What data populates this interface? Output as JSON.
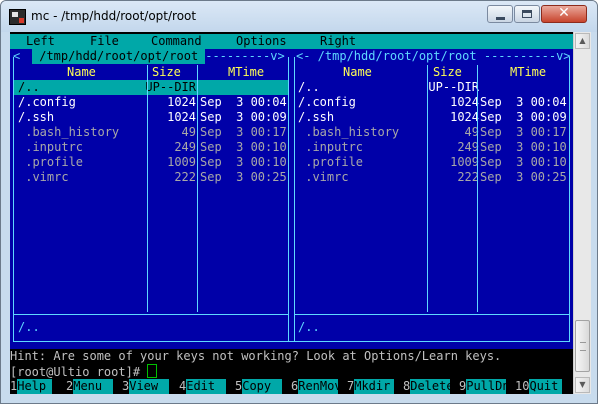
{
  "window": {
    "title": "mc - /tmp/hdd/root/opt/root"
  },
  "menu": [
    "Left",
    "File",
    "Command",
    "Options",
    "Right"
  ],
  "left_panel": {
    "path": " /tmp/hdd/root/opt/root ",
    "topbar_prefix": "<",
    "topbar_suffix": " ---------v>",
    "headers": {
      "name": "Name",
      "size": "Size",
      "mtime": "MTime"
    },
    "files": [
      {
        "name": "/..",
        "size": "UP--DIR",
        "mtime": ""
      },
      {
        "name": "/.config",
        "size": "1024",
        "mtime": "Sep  3 00:04"
      },
      {
        "name": "/.ssh",
        "size": "1024",
        "mtime": "Sep  3 00:09"
      },
      {
        "name": " .bash_history",
        "size": "49",
        "mtime": "Sep  3 00:17"
      },
      {
        "name": " .inputrc",
        "size": "249",
        "mtime": "Sep  3 00:10"
      },
      {
        "name": " .profile",
        "size": "1009",
        "mtime": "Sep  3 00:10"
      },
      {
        "name": " .vimrc",
        "size": "222",
        "mtime": "Sep  3 00:25"
      }
    ],
    "status": "/.."
  },
  "right_panel": {
    "path": "<- /tmp/hdd/root/opt/root ----------v>",
    "headers": {
      "name": "Name",
      "size": "Size",
      "mtime": "MTime"
    },
    "files": [
      {
        "name": "/..",
        "size": "UP--DIR",
        "mtime": ""
      },
      {
        "name": "/.config",
        "size": "1024",
        "mtime": "Sep  3 00:04"
      },
      {
        "name": "/.ssh",
        "size": "1024",
        "mtime": "Sep  3 00:09"
      },
      {
        "name": " .bash_history",
        "size": "49",
        "mtime": "Sep  3 00:17"
      },
      {
        "name": " .inputrc",
        "size": "249",
        "mtime": "Sep  3 00:10"
      },
      {
        "name": " .profile",
        "size": "1009",
        "mtime": "Sep  3 00:10"
      },
      {
        "name": " .vimrc",
        "size": "222",
        "mtime": "Sep  3 00:25"
      }
    ],
    "status": "/.."
  },
  "hint": "Hint: Are some of your keys not working? Look at Options/Learn keys.",
  "prompt": "[root@Ultio root]# ",
  "function_keys": [
    {
      "num": "1",
      "label": "Help"
    },
    {
      "num": "2",
      "label": "Menu"
    },
    {
      "num": "3",
      "label": "View"
    },
    {
      "num": "4",
      "label": "Edit"
    },
    {
      "num": "5",
      "label": "Copy"
    },
    {
      "num": "6",
      "label": "RenMov"
    },
    {
      "num": "7",
      "label": "Mkdir"
    },
    {
      "num": "8",
      "label": "Delete"
    },
    {
      "num": "9",
      "label": "PullDn"
    },
    {
      "num": "10",
      "label": "Quit"
    }
  ],
  "colors": {
    "panel_bg": "#0000a8",
    "menu_bg": "#00a8a8",
    "dir_text": "#ffffff",
    "file_text": "#5fd7ff",
    "highlight": "#ffff55"
  }
}
